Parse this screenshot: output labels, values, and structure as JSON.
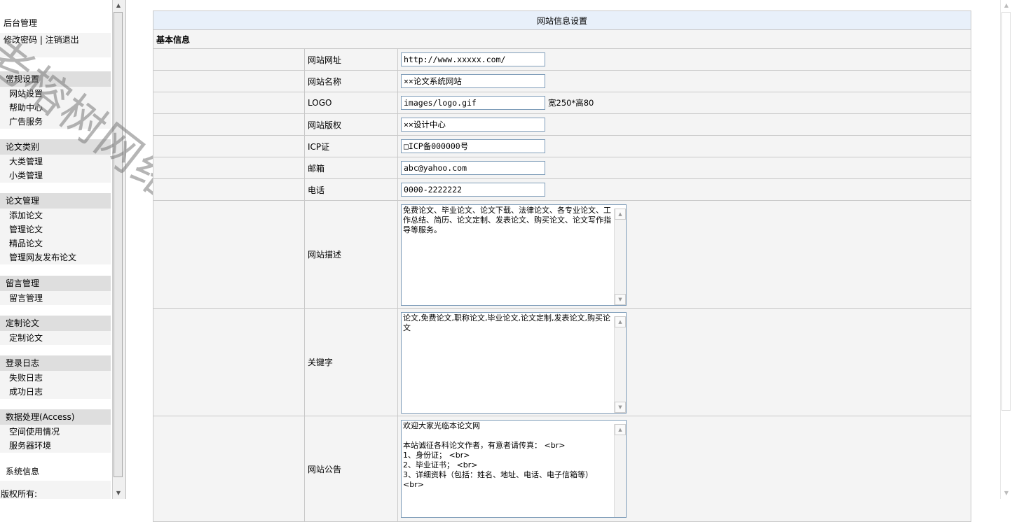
{
  "sidebar": {
    "title": "后台管理",
    "account_links": "修改密码 | 注销退出",
    "groups": [
      {
        "title": "常规设置",
        "items": [
          "网站设置",
          "帮助中心",
          "广告服务"
        ]
      },
      {
        "title": "论文类别",
        "items": [
          "大类管理",
          "小类管理"
        ]
      },
      {
        "title": "论文管理",
        "items": [
          "添加论文",
          "管理论文",
          "精品论文",
          "管理网友发布论文"
        ]
      },
      {
        "title": "留言管理",
        "items": [
          "留言管理"
        ]
      },
      {
        "title": "定制论文",
        "items": [
          "定制论文"
        ]
      },
      {
        "title": "登录日志",
        "items": [
          "失败日志",
          "成功日志"
        ]
      },
      {
        "title": "数据处理(Access)",
        "items": [
          "空间使用情况",
          "服务器环境"
        ]
      }
    ],
    "system_info": "系统信息",
    "copyright": "版权所有:"
  },
  "watermark": "老榕树网络",
  "panel": {
    "header": "网站信息设置",
    "section": "基本信息",
    "fields": {
      "url": {
        "label": "网站网址",
        "value": "http://www.xxxxx.com/"
      },
      "name": {
        "label": "网站名称",
        "value": "××论文系统网站"
      },
      "logo": {
        "label": "LOGO",
        "value": "images/logo.gif",
        "hint": "宽250*高80"
      },
      "copyright": {
        "label": "网站版权",
        "value": "××设计中心"
      },
      "icp": {
        "label": "ICP证",
        "value": "□ICP备000000号"
      },
      "email": {
        "label": "邮箱",
        "value": "abc@yahoo.com"
      },
      "phone": {
        "label": "电话",
        "value": "0000-2222222"
      },
      "description": {
        "label": "网站描述",
        "value": "免费论文、毕业论文、论文下载、法律论文、各专业论文、工作总结、简历、论文定制、发表论文、购买论文、论文写作指导等服务。"
      },
      "keywords": {
        "label": "关键字",
        "value": "论文,免费论文,职称论文,毕业论文,论文定制,发表论文,购买论文"
      },
      "notice": {
        "label": "网站公告",
        "value": "欢迎大家光临本论文网\n\n本站诚征各科论文作者，有意者请传真： <br>\n1、身份证； <br>\n2、毕业证书； <br>\n3、详细资料（包括：姓名、地址、电话、电子信箱等）<br>"
      }
    }
  },
  "icons": {
    "scroll_up": "arrow-up-icon",
    "scroll_down": "arrow-down-icon"
  }
}
